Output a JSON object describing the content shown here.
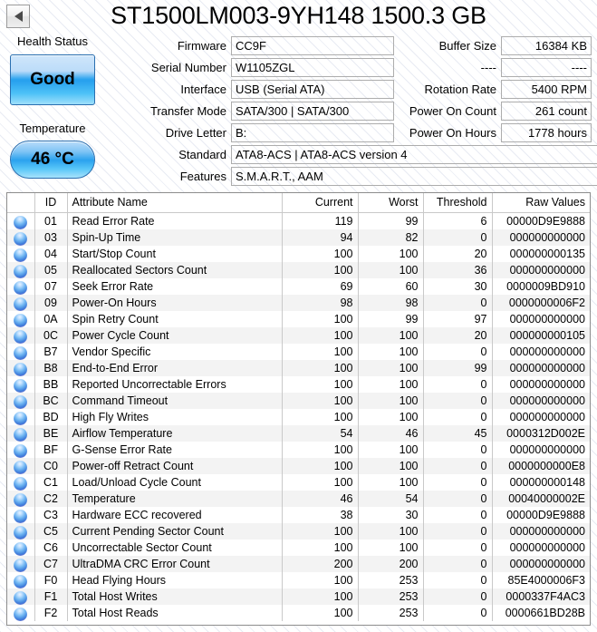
{
  "window": {
    "title": "ST1500LM003-9YH148 1500.3 GB",
    "back_button_icon": "triangle-left-icon"
  },
  "left_panel": {
    "health_status_label": "Health Status",
    "health_status_value": "Good",
    "health_status_color": "#27a0ee",
    "temperature_label": "Temperature",
    "temperature_value": "46 °C",
    "temperature_color": "#2ba2ee"
  },
  "info_fields": {
    "center": [
      {
        "label": "Firmware",
        "value": "CC9F"
      },
      {
        "label": "Serial Number",
        "value": "W1105ZGL"
      },
      {
        "label": "Interface",
        "value": "USB (Serial ATA)"
      },
      {
        "label": "Transfer Mode",
        "value": "SATA/300 | SATA/300"
      },
      {
        "label": "Drive Letter",
        "value": "B:"
      }
    ],
    "wide": [
      {
        "label": "Standard",
        "value": "ATA8-ACS | ATA8-ACS version 4"
      },
      {
        "label": "Features",
        "value": "S.M.A.R.T., AAM"
      }
    ],
    "right": [
      {
        "label": "Buffer Size",
        "value": "16384 KB"
      },
      {
        "label": "----",
        "value": "----"
      },
      {
        "label": "Rotation Rate",
        "value": "5400 RPM"
      },
      {
        "label": "Power On Count",
        "value": "261 count"
      },
      {
        "label": "Power On Hours",
        "value": "1778 hours"
      }
    ]
  },
  "smart_table": {
    "columns": [
      "",
      "ID",
      "Attribute Name",
      "Current",
      "Worst",
      "Threshold",
      "Raw Values"
    ],
    "rows": [
      {
        "status": "blue",
        "id": "01",
        "name": "Read Error Rate",
        "current": "119",
        "worst": "99",
        "threshold": "6",
        "raw": "00000D9E9888"
      },
      {
        "status": "blue",
        "id": "03",
        "name": "Spin-Up Time",
        "current": "94",
        "worst": "82",
        "threshold": "0",
        "raw": "000000000000"
      },
      {
        "status": "blue",
        "id": "04",
        "name": "Start/Stop Count",
        "current": "100",
        "worst": "100",
        "threshold": "20",
        "raw": "000000000135"
      },
      {
        "status": "blue",
        "id": "05",
        "name": "Reallocated Sectors Count",
        "current": "100",
        "worst": "100",
        "threshold": "36",
        "raw": "000000000000"
      },
      {
        "status": "blue",
        "id": "07",
        "name": "Seek Error Rate",
        "current": "69",
        "worst": "60",
        "threshold": "30",
        "raw": "0000009BD910"
      },
      {
        "status": "blue",
        "id": "09",
        "name": "Power-On Hours",
        "current": "98",
        "worst": "98",
        "threshold": "0",
        "raw": "0000000006F2"
      },
      {
        "status": "blue",
        "id": "0A",
        "name": "Spin Retry Count",
        "current": "100",
        "worst": "99",
        "threshold": "97",
        "raw": "000000000000"
      },
      {
        "status": "blue",
        "id": "0C",
        "name": "Power Cycle Count",
        "current": "100",
        "worst": "100",
        "threshold": "20",
        "raw": "000000000105"
      },
      {
        "status": "blue",
        "id": "B7",
        "name": "Vendor Specific",
        "current": "100",
        "worst": "100",
        "threshold": "0",
        "raw": "000000000000"
      },
      {
        "status": "blue",
        "id": "B8",
        "name": "End-to-End Error",
        "current": "100",
        "worst": "100",
        "threshold": "99",
        "raw": "000000000000"
      },
      {
        "status": "blue",
        "id": "BB",
        "name": "Reported Uncorrectable Errors",
        "current": "100",
        "worst": "100",
        "threshold": "0",
        "raw": "000000000000"
      },
      {
        "status": "blue",
        "id": "BC",
        "name": "Command Timeout",
        "current": "100",
        "worst": "100",
        "threshold": "0",
        "raw": "000000000000"
      },
      {
        "status": "blue",
        "id": "BD",
        "name": "High Fly Writes",
        "current": "100",
        "worst": "100",
        "threshold": "0",
        "raw": "000000000000"
      },
      {
        "status": "blue",
        "id": "BE",
        "name": "Airflow Temperature",
        "current": "54",
        "worst": "46",
        "threshold": "45",
        "raw": "0000312D002E"
      },
      {
        "status": "blue",
        "id": "BF",
        "name": "G-Sense Error Rate",
        "current": "100",
        "worst": "100",
        "threshold": "0",
        "raw": "000000000000"
      },
      {
        "status": "blue",
        "id": "C0",
        "name": "Power-off Retract Count",
        "current": "100",
        "worst": "100",
        "threshold": "0",
        "raw": "0000000000E8"
      },
      {
        "status": "blue",
        "id": "C1",
        "name": "Load/Unload Cycle Count",
        "current": "100",
        "worst": "100",
        "threshold": "0",
        "raw": "000000000148"
      },
      {
        "status": "blue",
        "id": "C2",
        "name": "Temperature",
        "current": "46",
        "worst": "54",
        "threshold": "0",
        "raw": "00040000002E"
      },
      {
        "status": "blue",
        "id": "C3",
        "name": "Hardware ECC recovered",
        "current": "38",
        "worst": "30",
        "threshold": "0",
        "raw": "00000D9E9888"
      },
      {
        "status": "blue",
        "id": "C5",
        "name": "Current Pending Sector Count",
        "current": "100",
        "worst": "100",
        "threshold": "0",
        "raw": "000000000000"
      },
      {
        "status": "blue",
        "id": "C6",
        "name": "Uncorrectable Sector Count",
        "current": "100",
        "worst": "100",
        "threshold": "0",
        "raw": "000000000000"
      },
      {
        "status": "blue",
        "id": "C7",
        "name": "UltraDMA CRC Error Count",
        "current": "200",
        "worst": "200",
        "threshold": "0",
        "raw": "000000000000"
      },
      {
        "status": "blue",
        "id": "F0",
        "name": "Head Flying Hours",
        "current": "100",
        "worst": "253",
        "threshold": "0",
        "raw": "85E4000006F3"
      },
      {
        "status": "blue",
        "id": "F1",
        "name": "Total Host Writes",
        "current": "100",
        "worst": "253",
        "threshold": "0",
        "raw": "0000337F4AC3"
      },
      {
        "status": "blue",
        "id": "F2",
        "name": "Total Host Reads",
        "current": "100",
        "worst": "253",
        "threshold": "0",
        "raw": "0000661BD28B"
      }
    ]
  }
}
